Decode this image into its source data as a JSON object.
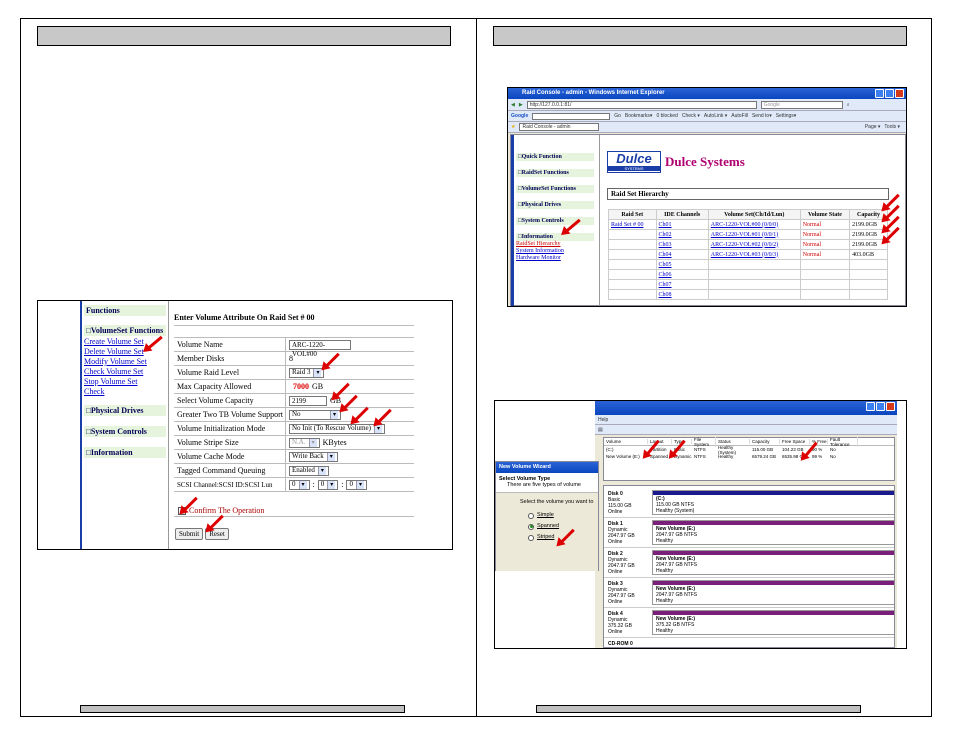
{
  "colors": {
    "arrow": "#dd0000",
    "link": "#0000cc",
    "menu_bg": "#e6f4dd",
    "xp_title": "#0a46c0",
    "basic_band": "#1a1a8c",
    "spanned_band": "#7a1f7a"
  },
  "left_shot": {
    "menu": {
      "functions_label": "Functions",
      "volumeset_label": "□VolumeSet Functions",
      "links": [
        "Create Volume Set",
        "Delete Volume Set",
        "Modify Volume Set",
        "Check Volume Set",
        "Stop Volume Set",
        "Check"
      ],
      "physical_drives_label": "□Physical Drives",
      "system_controls_label": "□System Controls",
      "information_label": "□Information"
    },
    "form": {
      "title": "Enter Volume Attribute On Raid Set # 00",
      "rows": [
        {
          "label": "Volume Name",
          "value": "ARC-1220-VOL#00"
        },
        {
          "label": "Member Disks",
          "value": "8"
        },
        {
          "label": "Volume Raid Level",
          "value": "Raid 3"
        },
        {
          "label": "Max Capacity Allowed",
          "value": "7000",
          "unit": "GB"
        },
        {
          "label": "Select Volume Capacity",
          "value": "2199",
          "unit": "GB"
        },
        {
          "label": "Greater Two TB Volume Support",
          "value": "No"
        },
        {
          "label": "Volume Initialization Mode",
          "value": "No Init (To Rescue Volume)"
        },
        {
          "label": "Volume Stripe Size",
          "value": "N.A.",
          "unit": "KBytes"
        },
        {
          "label": "Volume Cache Mode",
          "value": "Write Back"
        },
        {
          "label": "Tagged Command Queuing",
          "value": "Enabled"
        },
        {
          "label": "SCSI Channel:SCSI ID:SCSI Lun",
          "values": [
            "0",
            "0",
            "0"
          ]
        }
      ],
      "confirm_label": "Confirm The Operation",
      "submit_label": "Submit",
      "reset_label": "Reset"
    }
  },
  "ie_shot": {
    "window_title": "Raid Console - admin - Windows Internet Explorer",
    "address": "http://127.0.0.1:81/",
    "search_placeholder": "Google",
    "google_label": "Google",
    "tab_label": "Raid Console - admin",
    "toolbar_items": [
      "Go",
      "Bookmarks▾",
      "0 blocked",
      "Check ▾",
      "AutoLink ▾",
      "AutoFill",
      "Send to▾",
      "Settings▾"
    ],
    "page_tools": [
      "Page ▾",
      "Tools ▾"
    ],
    "menu": [
      "□Quick Function",
      "□RaidSet Functions",
      "□VolumeSet Functions",
      "□Physical Drives",
      "□System Controls",
      "□Information"
    ],
    "info_links": [
      "RaidSet Hierarchy",
      "System Information",
      "Hardware Monitor"
    ],
    "logo": "Dulce",
    "logo_sub": "SYSTEMS",
    "brand": "Dulce Systems",
    "section_title": "Raid Set Hierarchy",
    "table": {
      "headers": [
        "Raid Set",
        "IDE Channels",
        "Volume Set(Ch/Id/Lun)",
        "Volume State",
        "Capacity"
      ],
      "rows": [
        [
          "Raid Set # 00",
          "Ch01",
          "ARC-1220-VOL#00 (0/0/0)",
          "Normal",
          "2199.0GB"
        ],
        [
          "",
          "Ch02",
          "ARC-1220-VOL#01 (0/0/1)",
          "Normal",
          "2199.0GB"
        ],
        [
          "",
          "Ch03",
          "ARC-1220-VOL#02 (0/0/2)",
          "Normal",
          "2199.0GB"
        ],
        [
          "",
          "Ch04",
          "ARC-1220-VOL#03 (0/0/3)",
          "Normal",
          "403.0GB"
        ],
        [
          "",
          "Ch05",
          "",
          "",
          ""
        ],
        [
          "",
          "Ch06",
          "",
          "",
          ""
        ],
        [
          "",
          "Ch07",
          "",
          "",
          ""
        ],
        [
          "",
          "Ch08",
          "",
          "",
          ""
        ]
      ]
    }
  },
  "dm_shot": {
    "menu_help": "Help",
    "columns": [
      "Volume",
      "Layout",
      "Type",
      "File System",
      "Status",
      "Capacity",
      "Free Space",
      "% Free",
      "Fault Tolerance"
    ],
    "volumes": [
      [
        "(C:)",
        "Partition",
        "Basic",
        "NTFS",
        "Healthy (System)",
        "115.00 GB",
        "104.23 GB",
        "90 %",
        "No"
      ],
      [
        "New Volume (E:)",
        "Spanned",
        "Dynamic",
        "NTFS",
        "Healthy",
        "6579.24 GB",
        "6535.98 GB",
        "99 %",
        "No"
      ]
    ],
    "wizard": {
      "title": "New Volume Wizard",
      "heading": "Select Volume Type",
      "sub": "There are five types of volume",
      "prompt": "Select the volume you want to",
      "options": [
        "Simple",
        "Spanned",
        "Striped"
      ],
      "selected": "Spanned"
    },
    "disks": [
      {
        "name": "Disk 0",
        "type": "Basic",
        "size": "115.00 GB",
        "state": "Online",
        "vol": "(C:)",
        "vol_size": "115.00 GB NTFS",
        "vol_state": "Healthy (System)"
      },
      {
        "name": "Disk 1",
        "type": "Dynamic",
        "size": "2047.97 GB",
        "state": "Online",
        "vol": "New Volume (E:)",
        "vol_size": "2047.97 GB NTFS",
        "vol_state": "Healthy"
      },
      {
        "name": "Disk 2",
        "type": "Dynamic",
        "size": "2047.97 GB",
        "state": "Online",
        "vol": "New Volume (E:)",
        "vol_size": "2047.97 GB NTFS",
        "vol_state": "Healthy"
      },
      {
        "name": "Disk 3",
        "type": "Dynamic",
        "size": "2047.97 GB",
        "state": "Online",
        "vol": "New Volume (E:)",
        "vol_size": "2047.97 GB NTFS",
        "vol_state": "Healthy"
      },
      {
        "name": "Disk 4",
        "type": "Dynamic",
        "size": "375.32 GB",
        "state": "Online",
        "vol": "New Volume (E:)",
        "vol_size": "375.32 GB NTFS",
        "vol_state": "Healthy"
      }
    ],
    "partial_label": "CD-ROM 0"
  }
}
